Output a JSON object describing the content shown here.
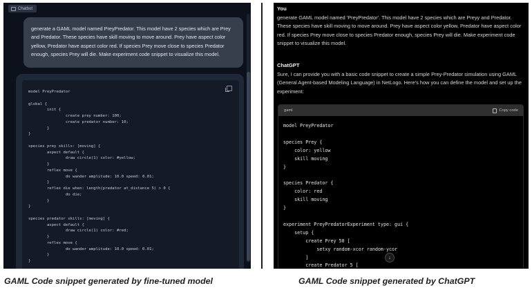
{
  "left_panel": {
    "tab_label": "Chatbot",
    "user_message": "generate a GAML model named PreyPredator. This model have 2 species which are Prey and Predator. These species have skill moving to move around. Prey have aspect color yellow, Predator have aspect color red. If species Prey move close to species Predator enough, species Prey will die. Make experiment code snippet to visualize this model.",
    "code_lines": [
      "model PreyPredator",
      "",
      "global {",
      "        init {",
      "                create prey number: 100;",
      "                create predator number: 10;",
      "        }",
      "}",
      "",
      "species prey skills: [moving] {",
      "        aspect default {",
      "                draw circle(1) color: #yellow;",
      "        }",
      "        reflex move {",
      "                do wander amplitude: 10.0 speed: 0.01;",
      "        }",
      "        reflex die when: length(predator at_distance 5) > 0 {",
      "                do die;",
      "        }",
      "}",
      "",
      "species predator skills: [moving] {",
      "        aspect default {",
      "                draw circle(1) color: #red;",
      "        }",
      "        reflex move {",
      "                do wander amplitude: 10.0 speed: 0.01;",
      "        }",
      "}"
    ]
  },
  "right_panel": {
    "user_label": "You",
    "user_message": "generate GAML model named 'PreyPredator'. This model have 2 species which are Preyy and Predator. These species have skill moving to move around. Prey have aspect color yellow, Predator have aspect color red. If species Prey move close to species Predator enough, species Prey will die. Make experiment code snippet to visualize this model.",
    "assistant_label": "ChatGPT",
    "assistant_message": "Sure, I can provide you with a basic code snippet to create a simple Prey-Predator simulation using GAML (General Agent-based Modeling Language) in NetLogo. Here's how you can define the model and set up the experiment:",
    "code_language": "gaml",
    "copy_label": "Copy code",
    "code_lines": [
      "model PreyPredator",
      "",
      "species Prey {",
      "    color: yellow",
      "    skill moving",
      "}",
      "",
      "species Predator {",
      "    color: red",
      "    skill moving",
      "}",
      "",
      "experiment PreyPredatorExperiment type: gui {",
      "    setup {",
      "        create Prey 50 [",
      "            setxy random-xcor random-ycor",
      "        ]",
      "        create Predator 5 ["
    ],
    "scroll_down_icon": "arrow-down-icon"
  },
  "captions": {
    "left": "GAML Code snippet generated by fine-tuned model",
    "right": "GAML Code snippet generated by ChatGPT"
  },
  "colors": {
    "left_background": "#0c111b",
    "left_user_bubble": "#373f4d",
    "left_code_background": "#141b26",
    "right_background": "#000000",
    "right_code_header": "#2f2f2f"
  }
}
